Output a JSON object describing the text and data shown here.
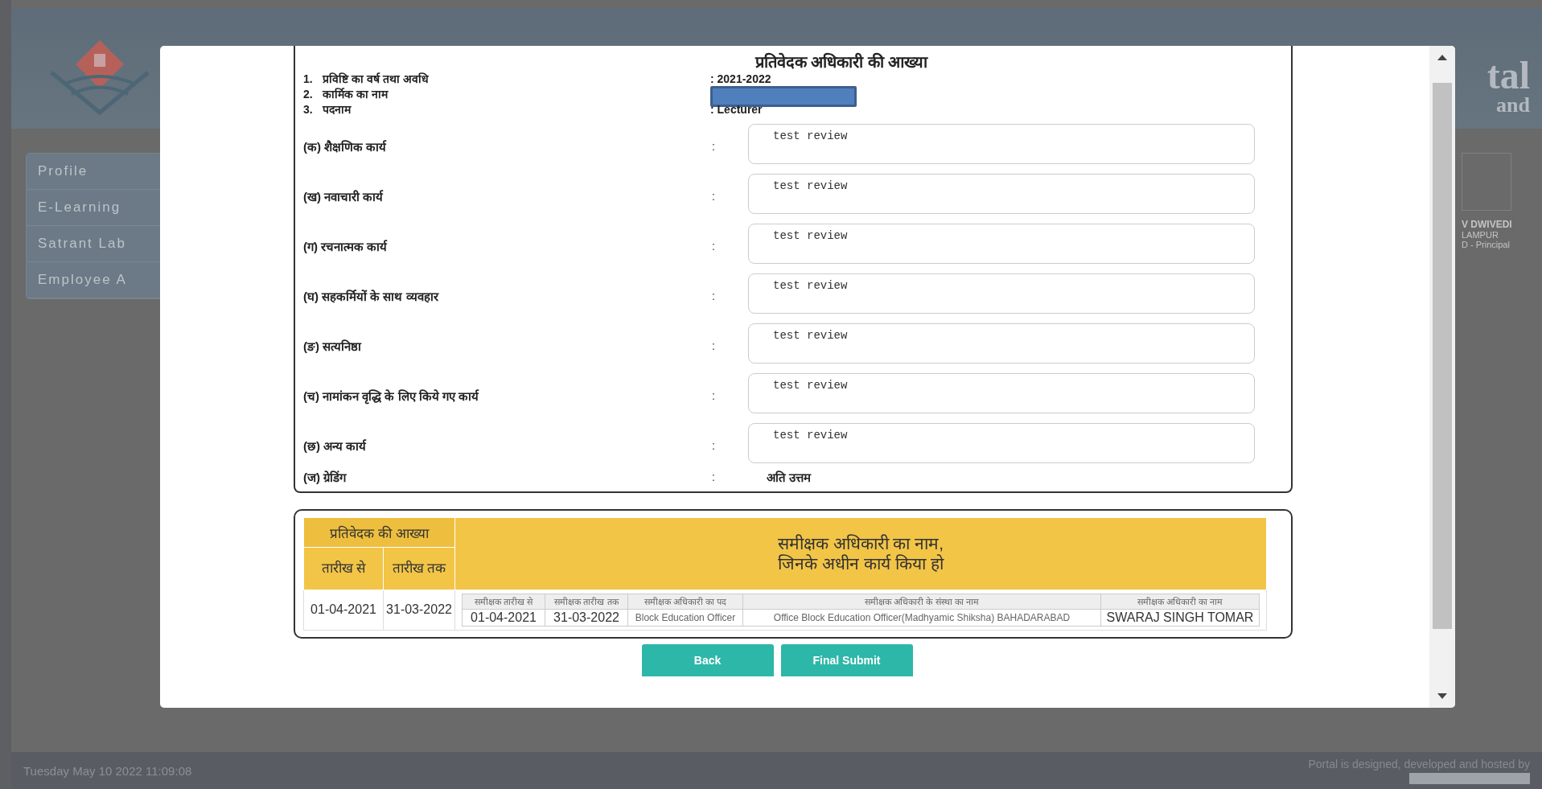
{
  "background": {
    "header_title_fragment": "tal",
    "header_subtitle_fragment": "and",
    "sidebar_items": [
      "Profile",
      "E-Learning",
      "Satrant Lab",
      "Employee A"
    ],
    "user_info": [
      "V DWIVEDI",
      "LAMPUR",
      "D - Principal"
    ]
  },
  "modal": {
    "title": "प्रतिवेदक अधिकारी की आख्या",
    "info": [
      {
        "number": "1.",
        "label": "प्रविष्टि का वर्ष तथा अवधि",
        "value": ": 2021-2022"
      },
      {
        "number": "2.",
        "label": "कार्मिक का नाम",
        "redacted": true
      },
      {
        "number": "3.",
        "label": "पदनाम",
        "value": ": Lecturer"
      }
    ],
    "fields": [
      {
        "label": "(क) शैक्षणिक कार्य",
        "separator": ":",
        "value": "test review"
      },
      {
        "label": "(ख) नवाचारी कार्य",
        "separator": ":",
        "value": "test review"
      },
      {
        "label": "(ग) रचनात्मक कार्य",
        "separator": ":",
        "value": "test review"
      },
      {
        "label": "(घ) सहकर्मियों के साथ व्यवहार",
        "separator": ":",
        "value": "test review"
      },
      {
        "label": "(ङ) सत्यनिष्ठा",
        "separator": ":",
        "value": "test review"
      },
      {
        "label": "(च) नामांकन वृद्धि के लिए किये गए कार्य",
        "separator": ":",
        "value": "test review"
      },
      {
        "label": "(छ) अन्य कार्य",
        "separator": ":",
        "value": "test review"
      }
    ],
    "grading": {
      "label": "(ज) ग्रेडिंग",
      "separator": ":",
      "value": "अति उत्तम"
    },
    "table": {
      "group_heading": "प्रतिवेदक की आख्या",
      "from_heading": "तारीख से",
      "to_heading": "तारीख तक",
      "reviewer_heading_lines": [
        "समीक्षक अधिकारी का नाम,",
        "जिनके अधीन कार्य किया हो"
      ],
      "rows": [
        {
          "from": "01-04-2021",
          "to": "31-03-2022",
          "reviewer_columns": [
            "समीक्षक तारीख से",
            "समीक्षक तारीख तक",
            "समीक्षक अधिकारी का पद",
            "समीक्षक अधिकारी के संस्था का नाम",
            "समीक्षक अधिकारी का नाम"
          ],
          "reviewer_rows": [
            [
              "01-04-2021",
              "31-03-2022",
              "Block Education Officer",
              "Office Block Education Officer(Madhyamic Shiksha) BAHADARABAD",
              "SWARAJ SINGH TOMAR"
            ]
          ]
        }
      ]
    },
    "buttons": [
      "Back",
      "Final Submit"
    ]
  },
  "footer": {
    "datetime": "Tuesday May 10 2022 11:09:08",
    "credit": "Portal is designed, developed and hosted by"
  }
}
